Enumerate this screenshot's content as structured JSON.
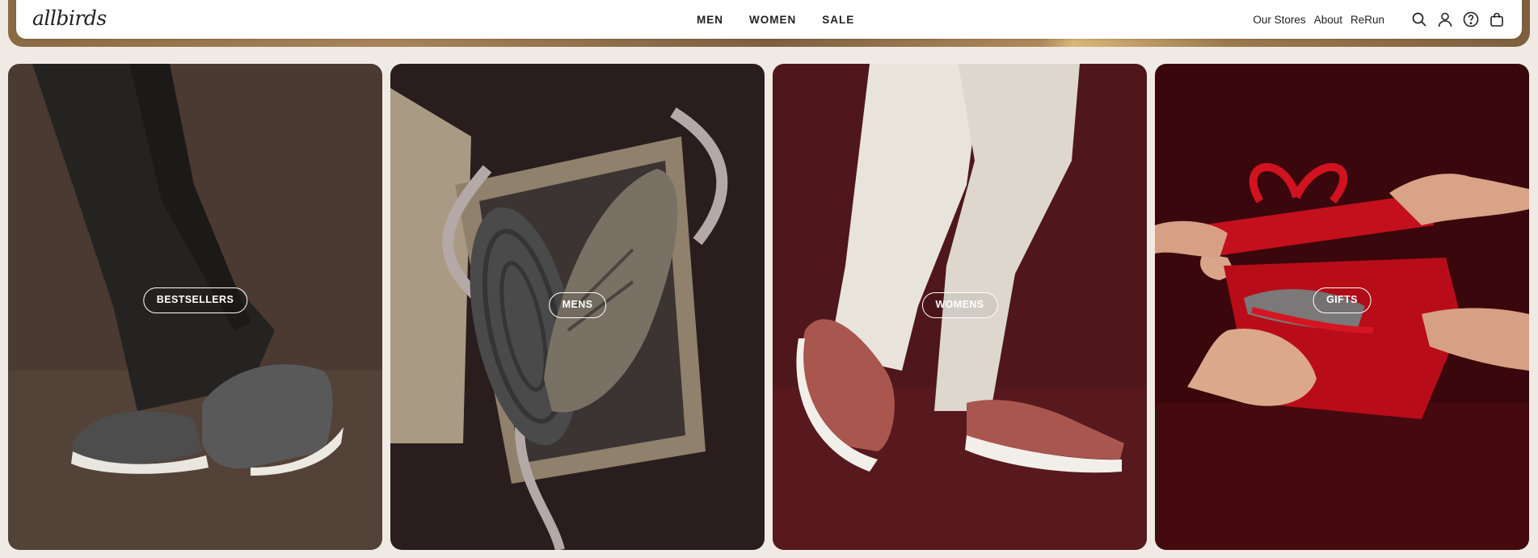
{
  "brand": {
    "logo_text": "allbirds"
  },
  "nav": {
    "center": [
      "MEN",
      "WOMEN",
      "SALE"
    ],
    "right_links": [
      "Our Stores",
      "About",
      "ReRun"
    ],
    "icons": [
      "search-icon",
      "account-icon",
      "help-icon",
      "cart-icon"
    ]
  },
  "colors": {
    "nav_bg": "#ffffff",
    "page_bg": "#efebe4",
    "card_bestsellers": "#4a3a31",
    "card_mens": "#2a1d1d",
    "card_womens": "#4f171b",
    "card_gifts": "#3a070d"
  },
  "cards": [
    {
      "label": "BESTSELLERS"
    },
    {
      "label": "MENS"
    },
    {
      "label": "WOMENS"
    },
    {
      "label": "GIFTS"
    }
  ]
}
